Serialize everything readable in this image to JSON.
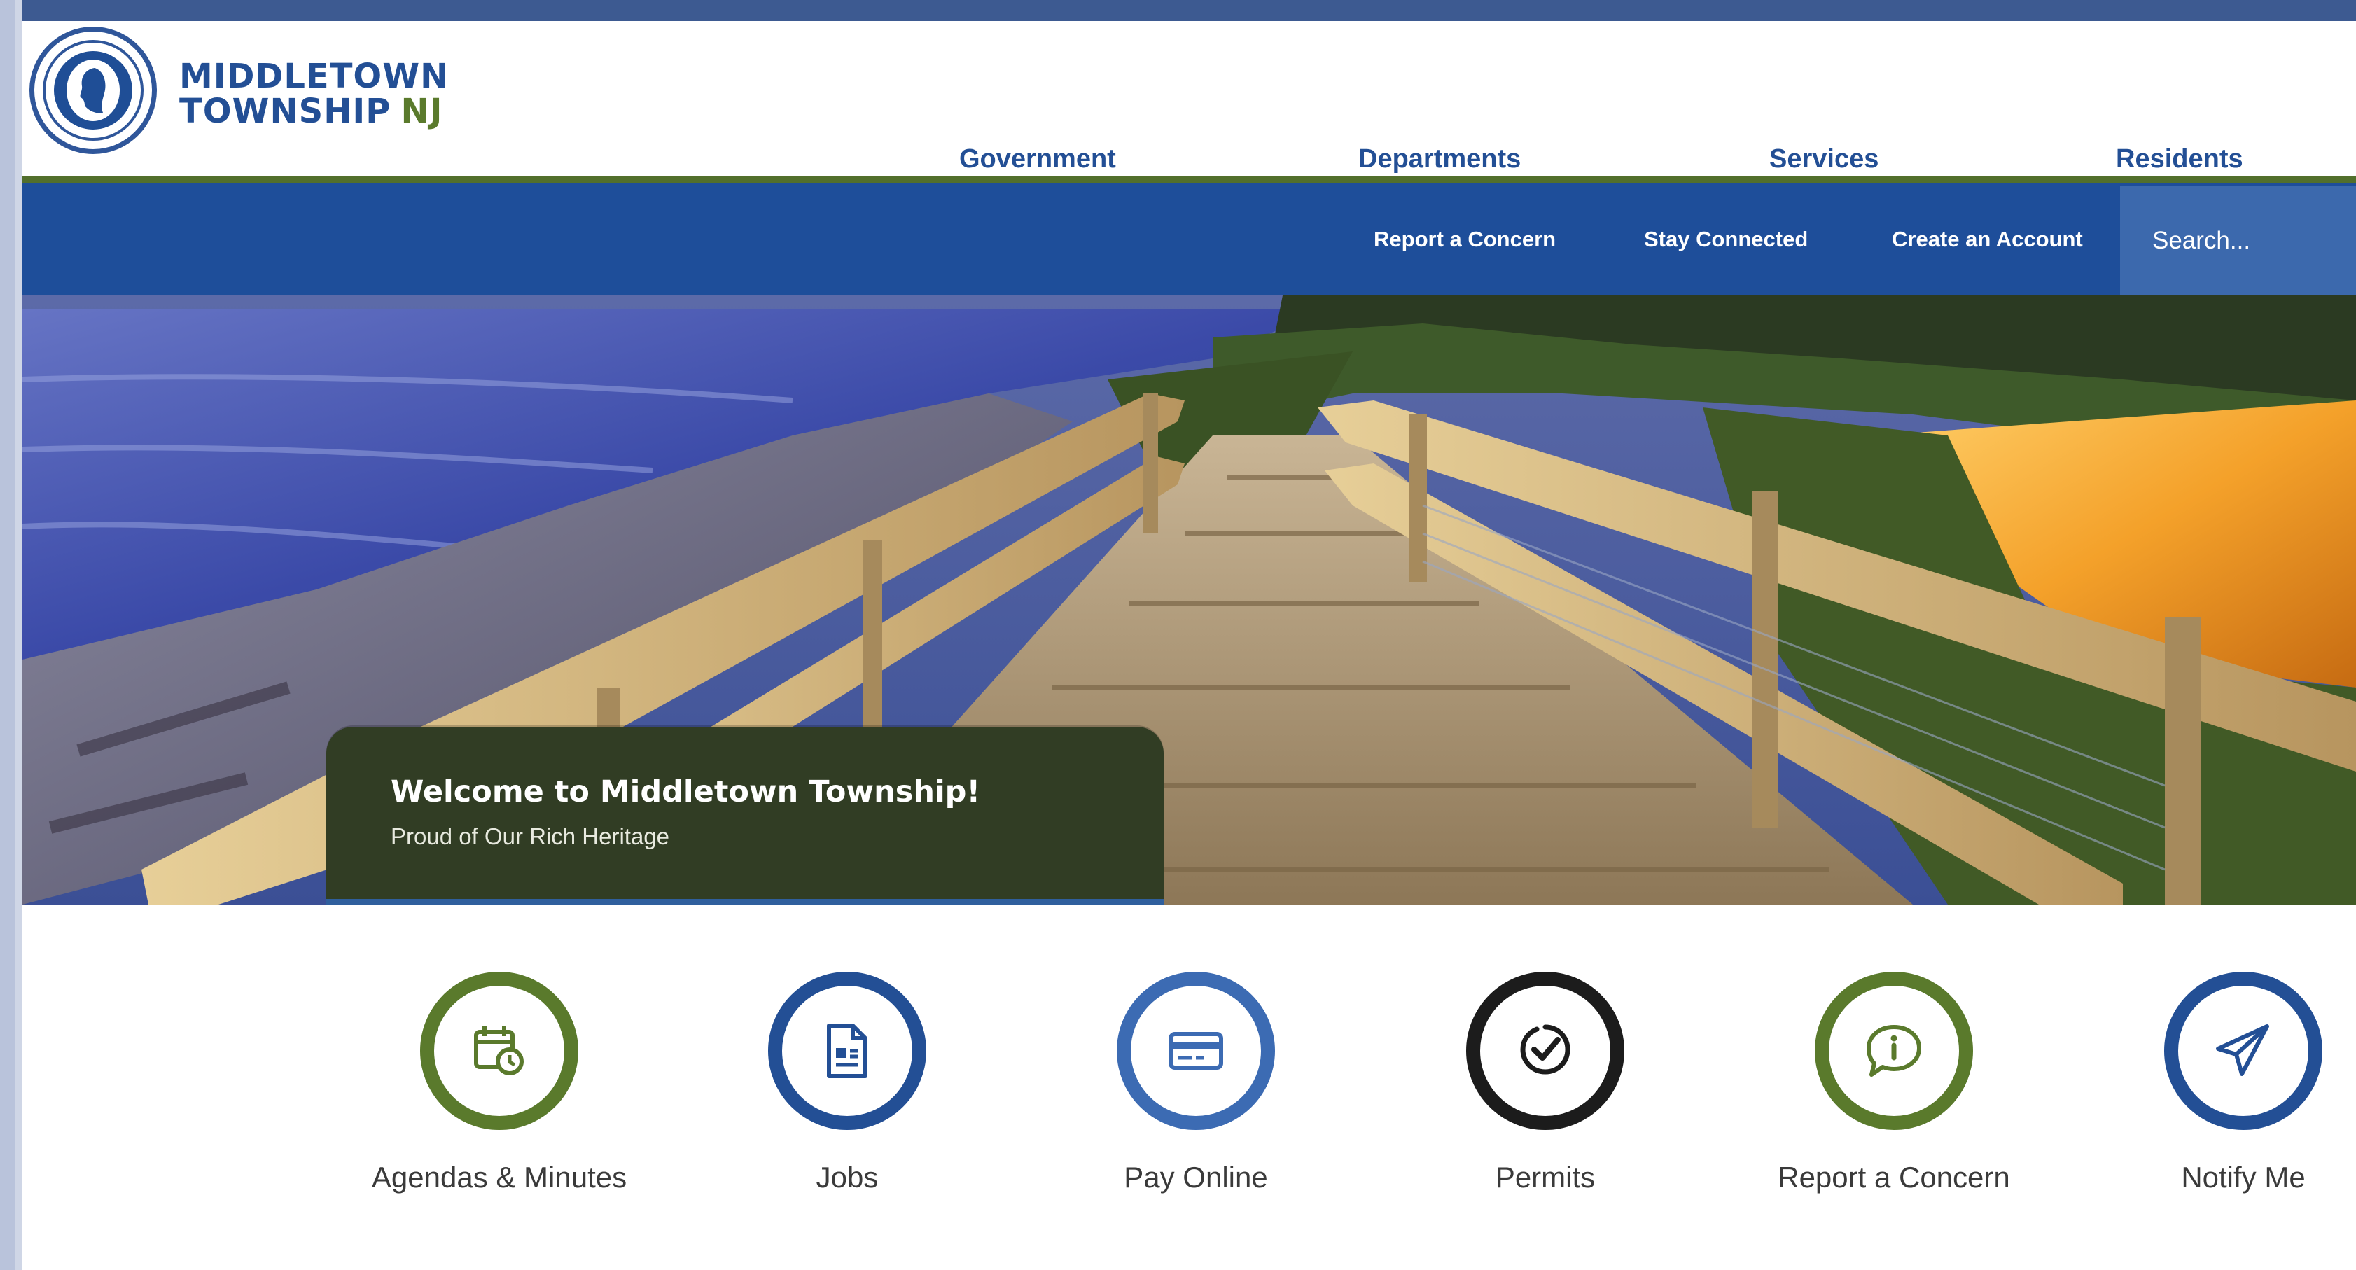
{
  "site": {
    "logo_line1": "MIDDLETOWN",
    "logo_line2": "TOWNSHIP",
    "logo_state": "NJ",
    "seal_icon": "township-seal-icon"
  },
  "main_nav": {
    "items": [
      {
        "label": "Government"
      },
      {
        "label": "Departments"
      },
      {
        "label": "Services"
      },
      {
        "label": "Residents"
      }
    ]
  },
  "utility_nav": {
    "items": [
      {
        "label": "Report a Concern"
      },
      {
        "label": "Stay Connected"
      },
      {
        "label": "Create an Account"
      }
    ],
    "search_placeholder": "Search..."
  },
  "hero": {
    "title": "Welcome to Middletown Township!",
    "subtitle": "Proud of Our Rich Heritage"
  },
  "quick_links": [
    {
      "label": "Agendas & Minutes",
      "icon": "calendar-clock-icon",
      "color": "#5a7a2c"
    },
    {
      "label": "Jobs",
      "icon": "document-icon",
      "color": "#234f95"
    },
    {
      "label": "Pay Online",
      "icon": "credit-card-icon",
      "color": "#3c6bb3"
    },
    {
      "label": "Permits",
      "icon": "check-badge-icon",
      "color": "#1c1c1c"
    },
    {
      "label": "Report a Concern",
      "icon": "info-chat-icon",
      "color": "#5a7a2c"
    },
    {
      "label": "Notify Me",
      "icon": "paper-plane-icon",
      "color": "#234f95"
    }
  ],
  "colors": {
    "brand_blue": "#234f95",
    "brand_green": "#5a7a2c",
    "utility_bar": "#1e4e9a"
  }
}
